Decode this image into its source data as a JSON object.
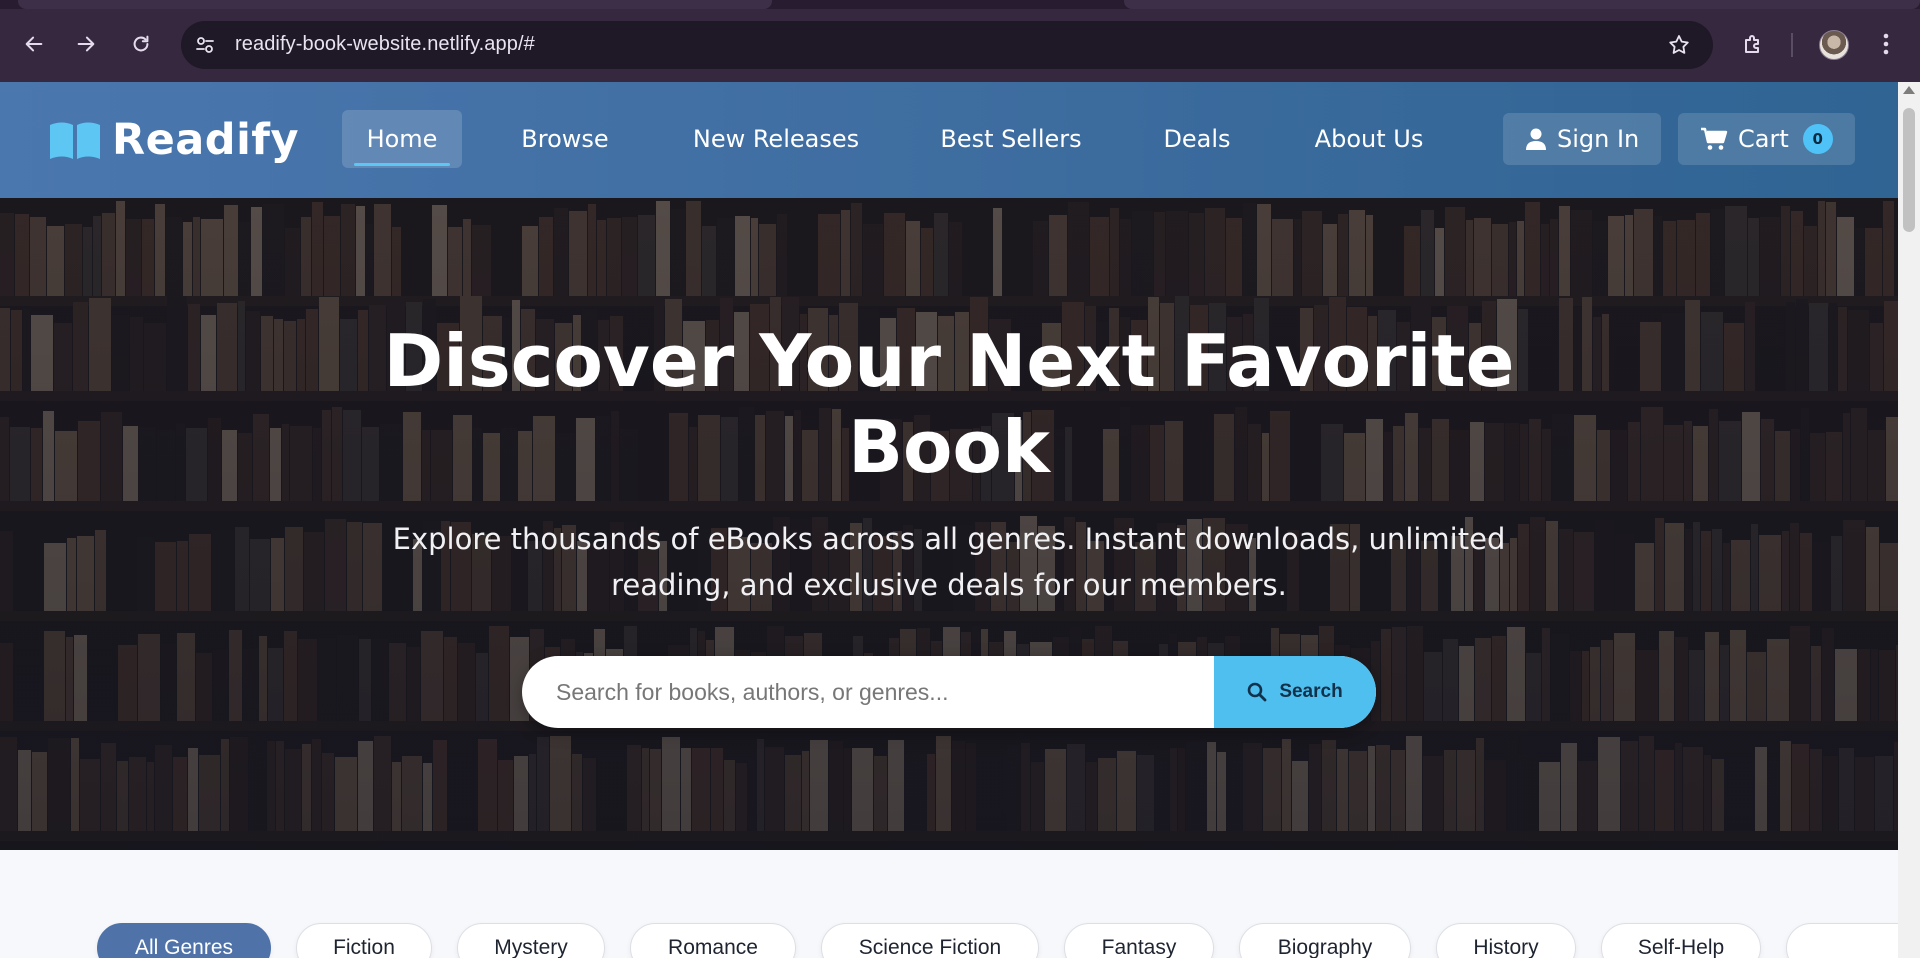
{
  "browser": {
    "url": "readify-book-website.netlify.app/#",
    "icons": [
      "back-icon",
      "forward-icon",
      "reload-icon",
      "site-info-icon",
      "bookmark-star-icon",
      "extensions-icon",
      "profile-avatar",
      "menu-icon"
    ]
  },
  "header": {
    "logo_text": "Readify",
    "nav": [
      {
        "label": "Home",
        "active": true
      },
      {
        "label": "Browse",
        "active": false
      },
      {
        "label": "New Releases",
        "active": false
      },
      {
        "label": "Best Sellers",
        "active": false
      },
      {
        "label": "Deals",
        "active": false
      },
      {
        "label": "About Us",
        "active": false
      }
    ],
    "sign_in_label": "Sign In",
    "cart_label": "Cart",
    "cart_count": "0"
  },
  "hero": {
    "title_line1": "Discover Your Next Favorite",
    "title_line2": "Book",
    "subtitle_line1": "Explore thousands of eBooks across all genres. Instant downloads, unlimited",
    "subtitle_line2": "reading, and exclusive deals for our members.",
    "search_placeholder": "Search for books, authors, or genres...",
    "search_button_label": "Search"
  },
  "genres": [
    {
      "label": "All Genres",
      "active": true
    },
    {
      "label": "Fiction",
      "active": false
    },
    {
      "label": "Mystery",
      "active": false
    },
    {
      "label": "Romance",
      "active": false
    },
    {
      "label": "Science Fiction",
      "active": false
    },
    {
      "label": "Fantasy",
      "active": false
    },
    {
      "label": "Biography",
      "active": false
    },
    {
      "label": "History",
      "active": false
    },
    {
      "label": "Self-Help",
      "active": false
    }
  ],
  "colors": {
    "header_start": "#4a77ae",
    "header_end": "#2f6493",
    "accent": "#4fbff0",
    "active_chip": "#4f73a8",
    "browser_chrome": "#35283f"
  }
}
